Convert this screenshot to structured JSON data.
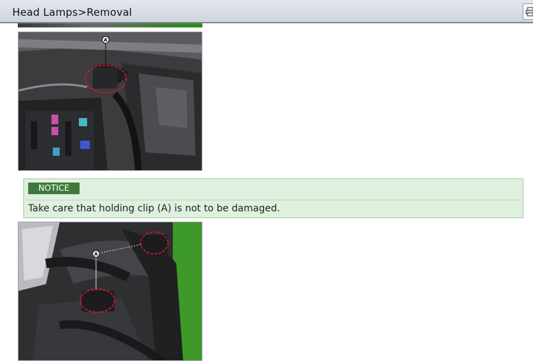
{
  "window": {
    "title": "Head Lamps>Removal"
  },
  "toolbar": {
    "print_icon": "printer-icon"
  },
  "notice": {
    "badge": "NOTICE",
    "text": "Take care that holding clip (A) is not to be damaged."
  },
  "figures": {
    "top": {
      "callout_label": "A"
    },
    "bottom": {
      "callout_label": "A"
    }
  },
  "colors": {
    "title_bar": "#d6dae2",
    "notice_bg": "#dff0de",
    "notice_badge": "#3f7a3a",
    "callout_ring": "#e0152d"
  }
}
